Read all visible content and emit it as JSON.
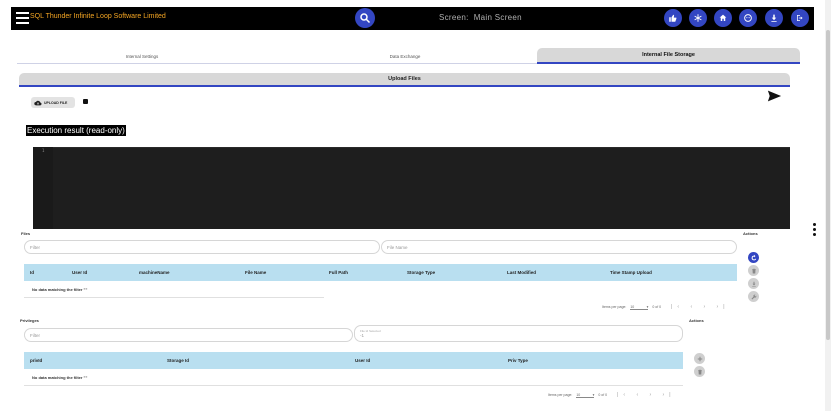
{
  "header": {
    "app_title": "SQL Thunder Infinite Loop Software Limited",
    "screen_label": "Screen:",
    "screen_name": "Main Screen",
    "actions": [
      "thumb-up-icon",
      "asterisk-icon",
      "home-icon",
      "mask-icon",
      "download-icon",
      "logout-icon"
    ]
  },
  "tabs": [
    {
      "label": "Internal Settings",
      "active": false
    },
    {
      "label": "Data Exchange",
      "active": false
    },
    {
      "label": "Internal File Storage",
      "active": true
    }
  ],
  "panel": {
    "title": "Upload Files",
    "upload_button": "UPLOAD FILE",
    "execution_label": "Execution result (read-only)",
    "editor_line_number": "1"
  },
  "files": {
    "section_label": "Files",
    "actions_label": "Actions",
    "filter_placeholder": "Filter",
    "filename_placeholder": "File Name",
    "columns": [
      "Id",
      "User Id",
      "machineName",
      "File Name",
      "Full Path",
      "Storage Type",
      "Last Modified",
      "Time Stamp Upload"
    ],
    "empty_text": "No data matching the filter \"\"",
    "pager": {
      "items_per_page_label": "Items per page:",
      "page_size": "10",
      "range": "0 of 0"
    }
  },
  "privileges": {
    "section_label": "Privileges",
    "actions_label": "Actions",
    "filter_placeholder": "Filter",
    "file_id_label": "File Id Selected",
    "file_id_value": "-1",
    "columns": [
      "privId",
      "Storage Id",
      "User Id",
      "Priv Type"
    ],
    "empty_text": "No data matching the filter \"\"",
    "pager": {
      "items_per_page_label": "Items per page:",
      "page_size": "10",
      "range": "0 of 0"
    }
  },
  "colors": {
    "accent": "#3346c2",
    "title": "#f5a623",
    "table_header": "#b9dff0",
    "editor_bg": "#1e1e1e"
  }
}
